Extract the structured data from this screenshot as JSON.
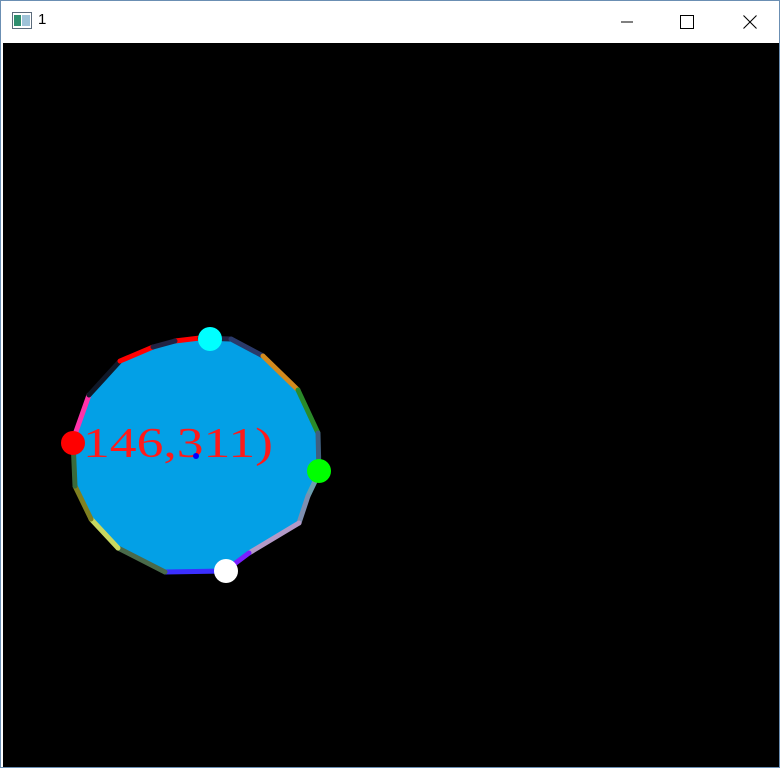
{
  "window": {
    "title": "1",
    "app_icon": "window-app-icon",
    "controls": {
      "minimize_icon": "minimize-icon",
      "maximize_icon": "maximize-icon",
      "close_icon": "close-icon"
    }
  },
  "canvas": {
    "background": "#000000",
    "fill_color": "#03a0e6",
    "coordinate_label": "146,311)",
    "label_color": "#ff1a1a",
    "center_marker_color": "#0000ff",
    "handles": [
      {
        "name": "handle-top",
        "color": "#00ffff"
      },
      {
        "name": "handle-left",
        "color": "#ff0000"
      },
      {
        "name": "handle-right",
        "color": "#00ff00"
      },
      {
        "name": "handle-bottom",
        "color": "#ffffff"
      }
    ],
    "edge_colors": [
      "#ff0000",
      "#222244",
      "#2a3a6a",
      "#d28a1e",
      "#2a8a2a",
      "#3f5f7f",
      "#6b9fb0",
      "#7e8fb0",
      "#b39ac8",
      "#7a1fff",
      "#3b2fff",
      "#4a6a4a",
      "#c8d860",
      "#808020",
      "#3a6a3a",
      "#ff33aa",
      "#101828"
    ]
  }
}
